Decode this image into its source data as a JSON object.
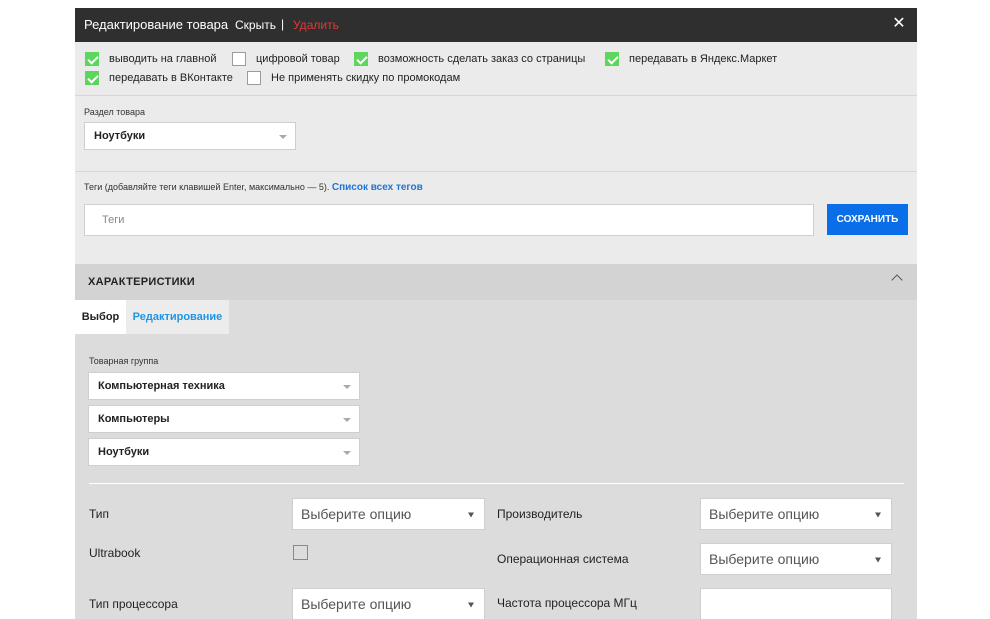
{
  "header": {
    "title": "Редактирование товара",
    "hide_label": "Скрыть",
    "separator": "|",
    "delete_label": "Удалить",
    "close_glyph": "✕"
  },
  "flags": [
    {
      "label": "выводить на главной",
      "checked": true
    },
    {
      "label": "цифровой товар",
      "checked": false
    },
    {
      "label": "возможность сделать заказ со страницы",
      "checked": true
    },
    {
      "label": "передавать в Яндекс.Маркет",
      "checked": true
    },
    {
      "label": "передавать в ВКонтакте",
      "checked": true
    },
    {
      "label": "Не применять скидку по промокодам",
      "checked": false
    }
  ],
  "section": {
    "label": "Раздел товара",
    "value": "Ноутбуки"
  },
  "tags": {
    "label": "Теги (добавляйте теги клавишей Enter, максимально — 5).",
    "link": "Список всех тегов",
    "placeholder": "Теги",
    "save_label": "СОХРАНИТЬ"
  },
  "characteristics": {
    "title": "ХАРАКТЕРИСТИКИ",
    "tabs": [
      {
        "label": "Выбор",
        "active": true
      },
      {
        "label": "Редактирование",
        "active": false
      }
    ],
    "group_label": "Товарная группа",
    "groups": [
      "Компьютерная техника",
      "Компьютеры",
      "Ноутбуки"
    ],
    "fields": {
      "type": {
        "label": "Тип",
        "value": "Выберите опцию"
      },
      "ultrabook": {
        "label": "Ultrabook",
        "checked": false
      },
      "cpu_type": {
        "label": "Тип процессора",
        "value": "Выберите опцию"
      },
      "manufacturer": {
        "label": "Производитель",
        "value": "Выберите опцию"
      },
      "os": {
        "label": "Операционная система",
        "value": "Выберите опцию"
      },
      "cpu_freq": {
        "label": "Частота процессора МГц",
        "value": ""
      }
    }
  },
  "colors": {
    "header_bg": "#2f2f2f",
    "delete_red": "#e53935",
    "check_green": "#5cd65c",
    "link_blue": "#1e74d6",
    "button_blue": "#0a6ee8",
    "tab_blue": "#1f95e3"
  }
}
